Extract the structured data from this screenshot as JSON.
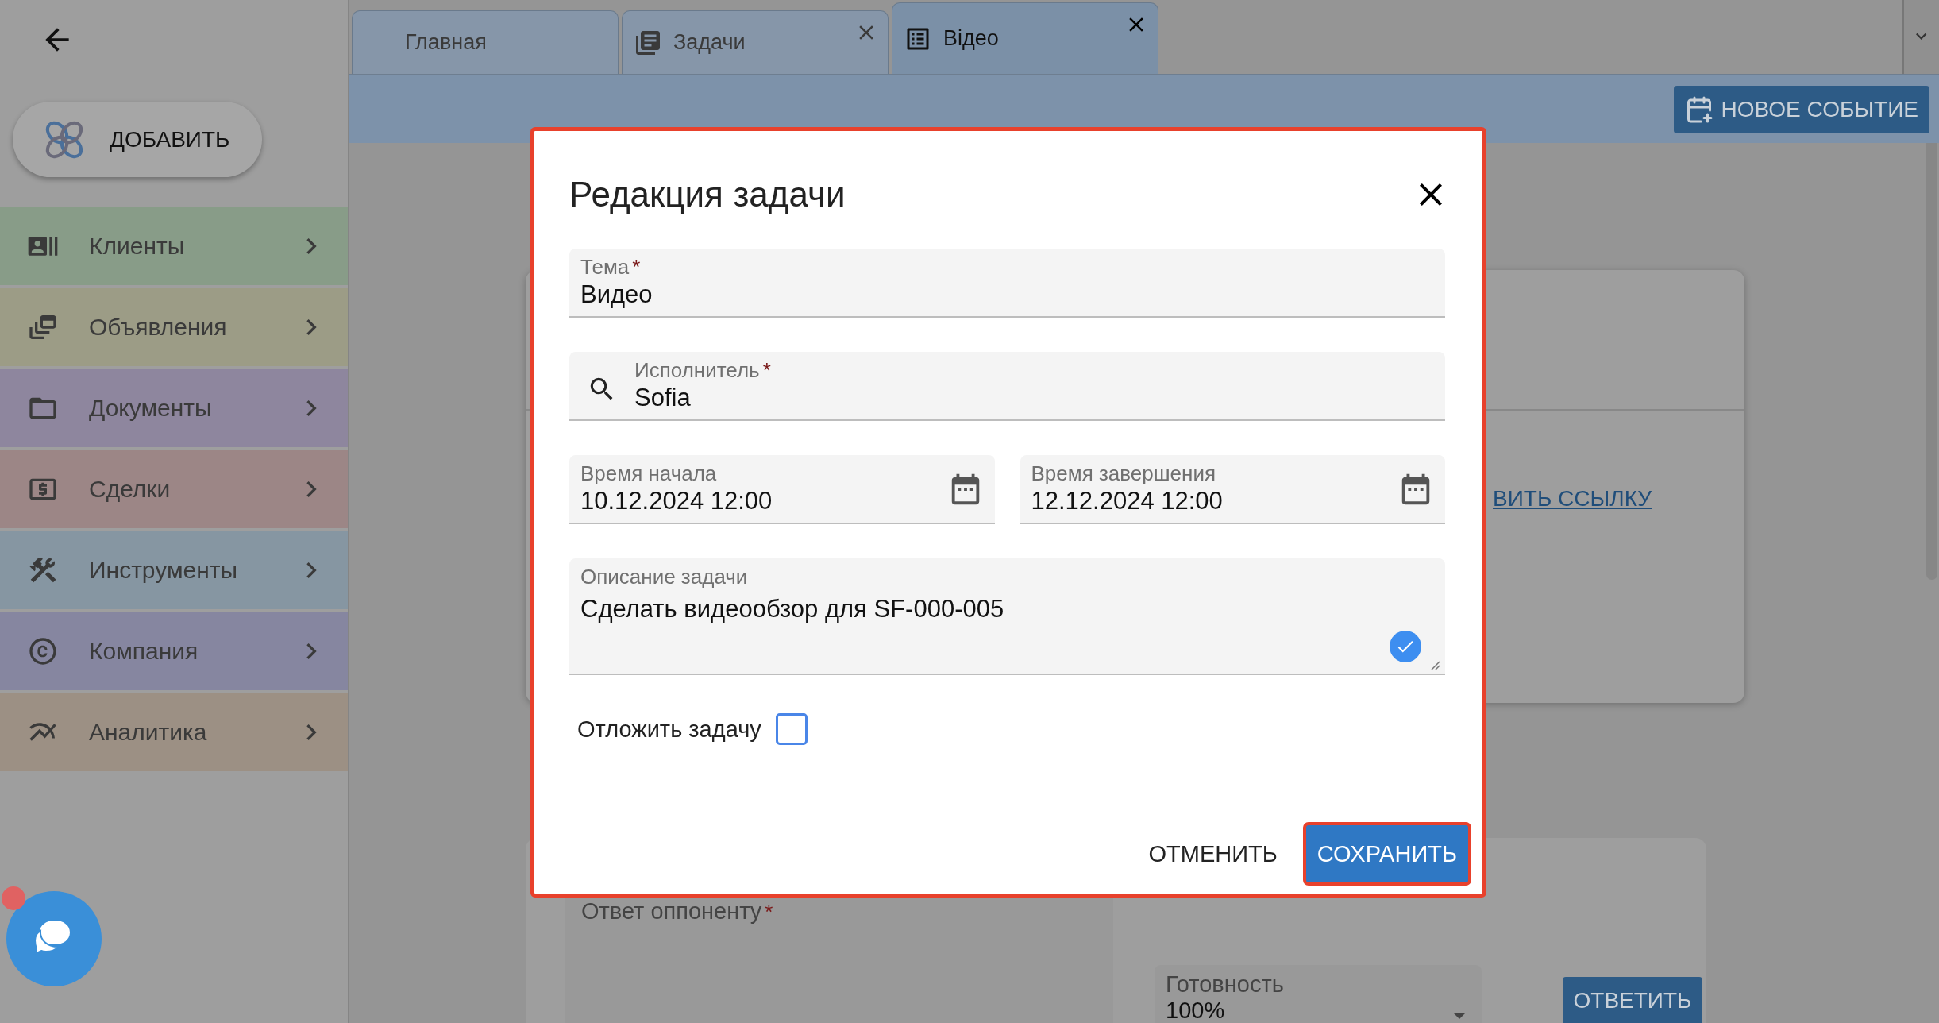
{
  "add_button": {
    "label": "ДОБАВИТЬ"
  },
  "sidebar": {
    "items": [
      {
        "label": "Клиенты",
        "kind": "contacts",
        "color": "#889c88"
      },
      {
        "label": "Объявления",
        "kind": "feed",
        "color": "#9c9c86"
      },
      {
        "label": "Документы",
        "kind": "folder",
        "color": "#8e869e"
      },
      {
        "label": "Сделки",
        "kind": "money",
        "color": "#9c8686"
      },
      {
        "label": "Инструменты",
        "kind": "tools",
        "color": "#8696a2"
      },
      {
        "label": "Компания",
        "kind": "company",
        "color": "#8686a0"
      },
      {
        "label": "Аналитика",
        "kind": "analytics",
        "color": "#9c9084"
      }
    ]
  },
  "chat": {
    "unread": true
  },
  "tabs": [
    {
      "label": "Главная",
      "kind": "plain",
      "closable": false,
      "selected": false
    },
    {
      "label": "Задачи",
      "kind": "tasks",
      "closable": true,
      "selected": false
    },
    {
      "label": "Відео",
      "kind": "document",
      "closable": true,
      "selected": true
    }
  ],
  "toolbar": {
    "new_event_button": "НОВОЕ СОБЫТИЕ"
  },
  "background": {
    "link": "ВИТЬ ССЫЛКУ",
    "reply_field": {
      "label": "Ответ оппоненту",
      "required_mark": "*"
    },
    "readiness": {
      "label": "Готовность",
      "value": "100%"
    },
    "reply_button": "ОТВЕТИТЬ"
  },
  "dialog": {
    "title": "Редакция задачи",
    "highlighted": true,
    "fields": [
      {
        "kind": "text",
        "label": "Тема",
        "required_mark": "*",
        "value": "Видео"
      },
      {
        "kind": "search",
        "label": "Исполнитель",
        "required_mark": "*",
        "value": "Sofia"
      },
      {
        "kind": "date",
        "label": "Время начала",
        "value": "10.12.2024 12:00"
      },
      {
        "kind": "date",
        "label": "Время завершения",
        "value": "12.12.2024 12:00"
      },
      {
        "kind": "textarea",
        "label": "Описание задачи",
        "value": "Сделать видеообзор для SF-000-005"
      }
    ],
    "postpone": {
      "label": "Отложить задачу",
      "checked": false
    },
    "buttons": [
      {
        "label": "ОТМЕНИТЬ",
        "kind": "text",
        "highlighted": false
      },
      {
        "label": "СОХРАНИТЬ",
        "kind": "primary",
        "highlighted": true
      }
    ]
  }
}
